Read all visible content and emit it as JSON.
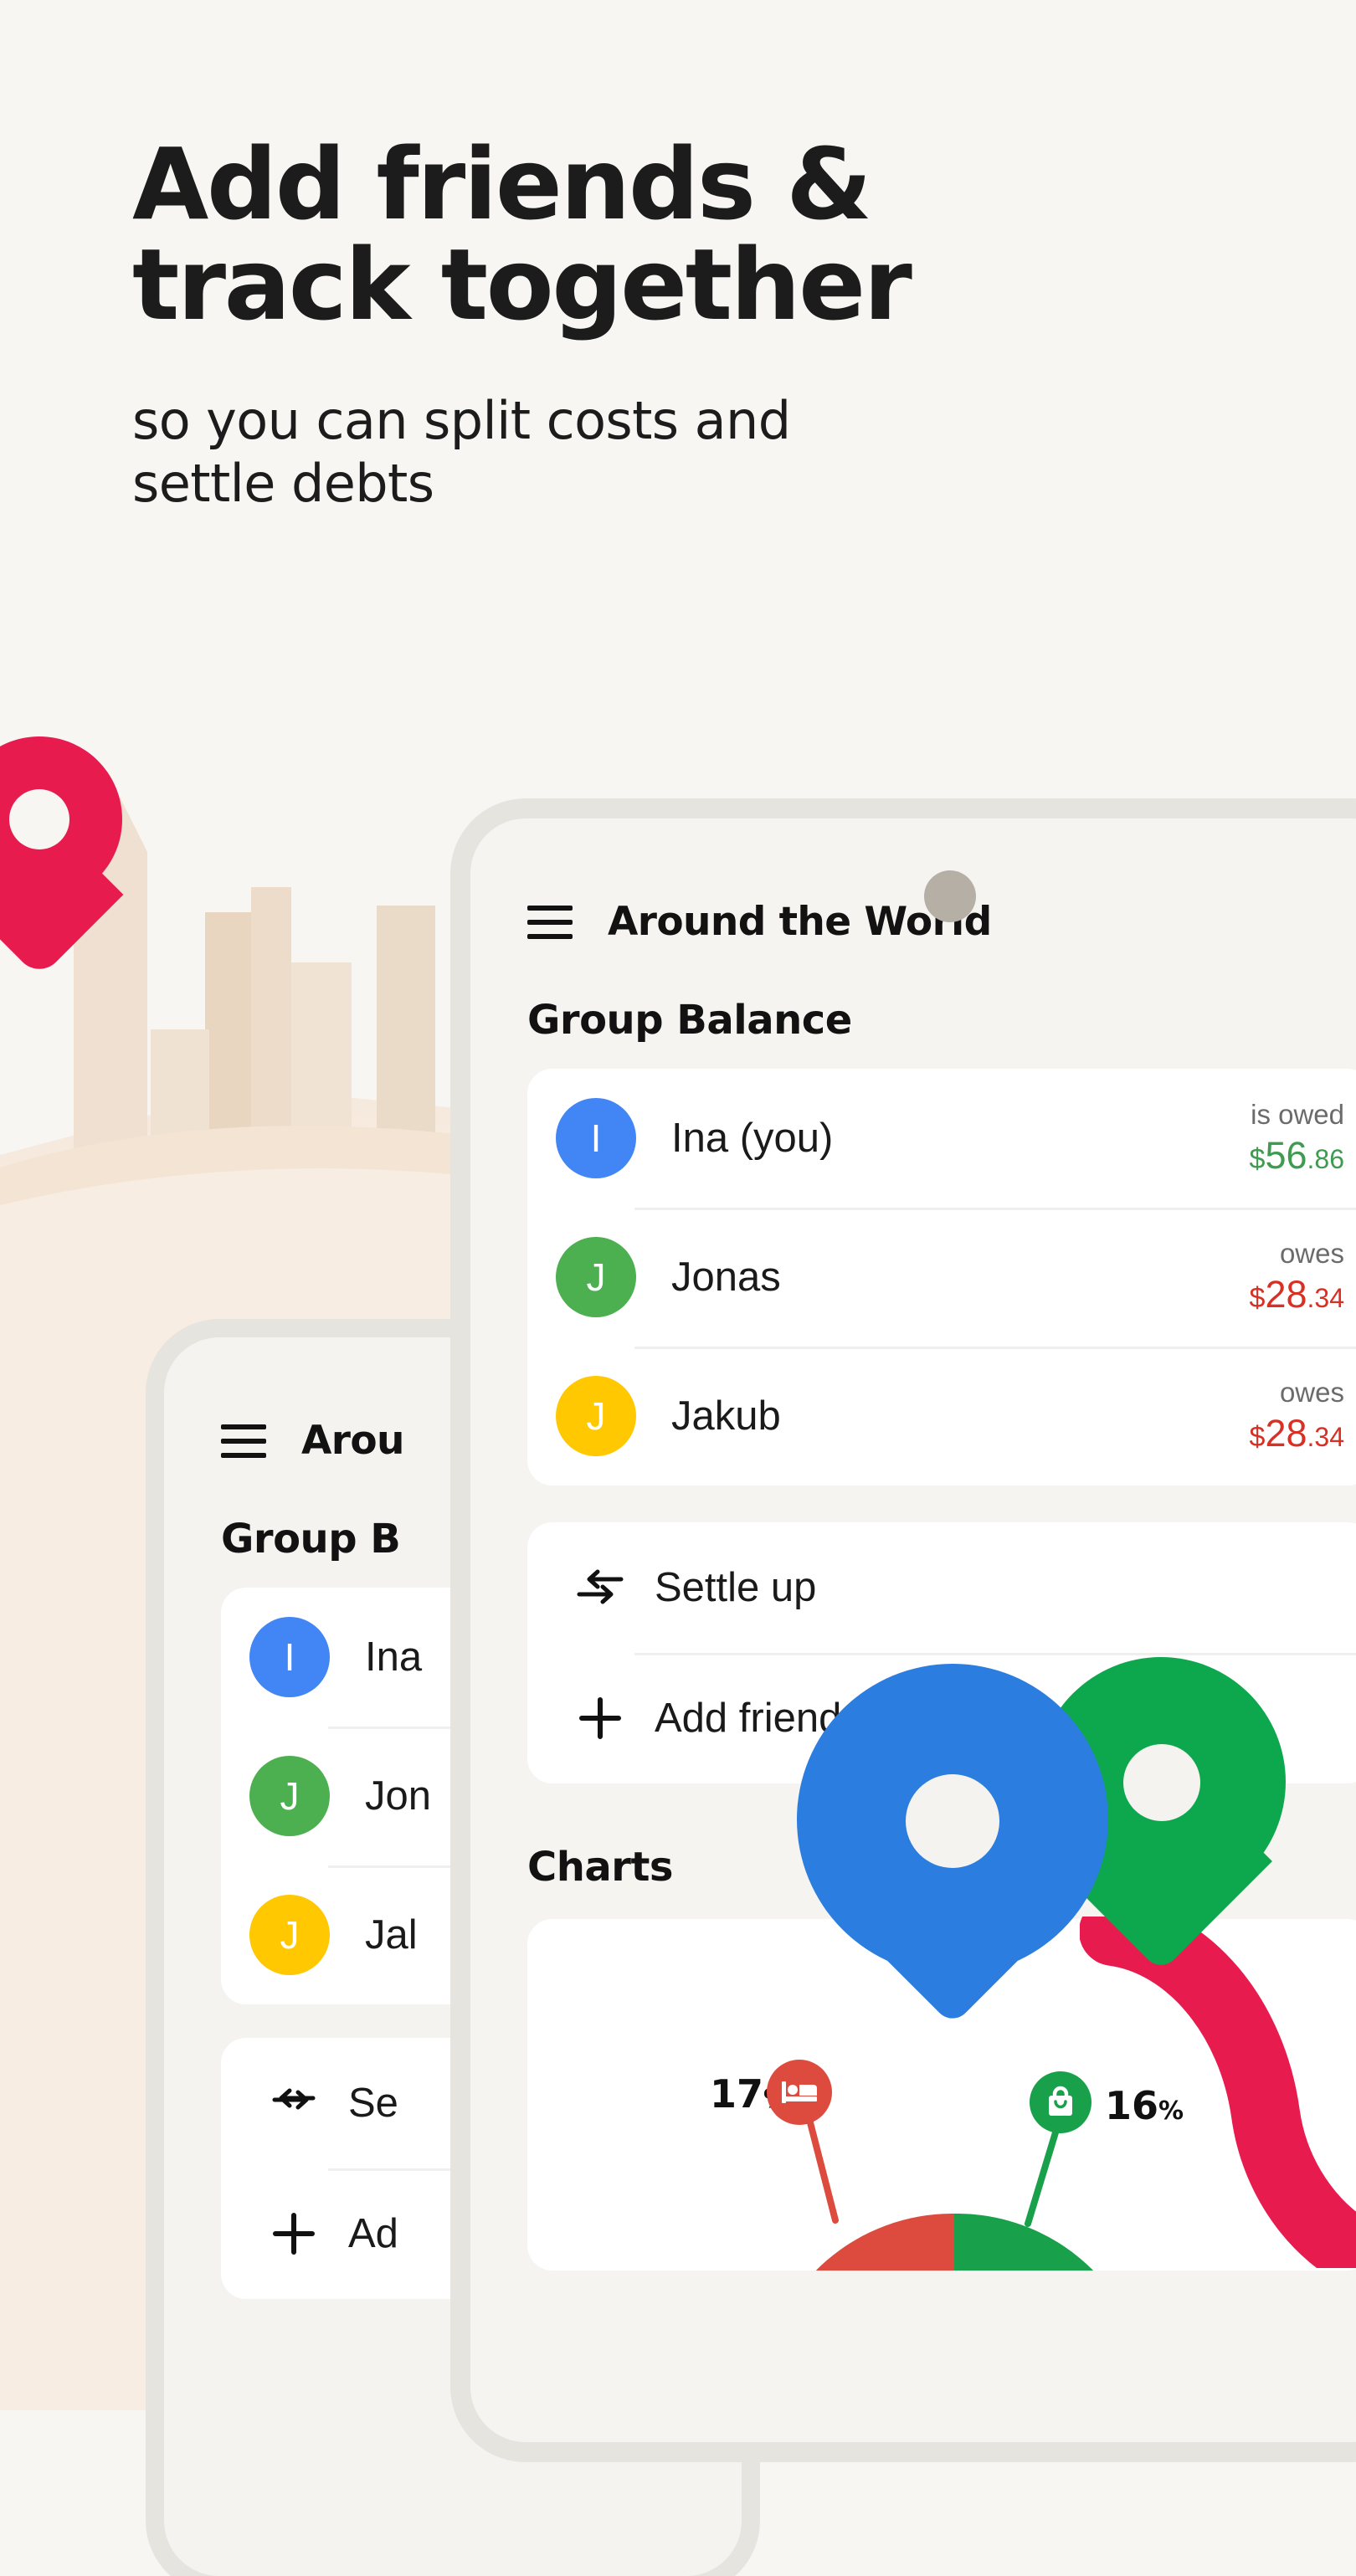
{
  "theme": {
    "background": "#F7F6F2",
    "card_background": "#FFFFFF",
    "phone_body": "#F5F4F0",
    "phone_bezel": "#E6E4DF",
    "text_primary": "#1C1C1C",
    "accent_crimson": "#E81B4F",
    "accent_blue": "#2B7DE0",
    "accent_green": "#0DA84E",
    "positive_green": "#3E9B4F",
    "negative_red": "#D93025",
    "muted_text": "#6B6B6B",
    "city_beige": "#E8D9C8",
    "city_sand": "#F2E6DA"
  },
  "hero": {
    "headline": "Add friends &\ntrack together",
    "subheadline": "so you can split costs and\nsettle debts"
  },
  "phone_front": {
    "app_title": "Around the World",
    "menu_icon": "hamburger-icon",
    "balance_section_title": "Group Balance",
    "members": [
      {
        "initial": "I",
        "avatar_color": "#4285F4",
        "name": "Ina (you)",
        "status": "is owed",
        "currency": "$",
        "whole": "56",
        "cents": ".86",
        "direction": "positive"
      },
      {
        "initial": "J",
        "avatar_color": "#4CAF50",
        "name": "Jonas",
        "status": "owes",
        "currency": "$",
        "whole": "28",
        "cents": ".34",
        "direction": "negative"
      },
      {
        "initial": "J",
        "avatar_color": "#FFC800",
        "name": "Jakub",
        "status": "owes",
        "currency": "$",
        "whole": "28",
        "cents": ".34",
        "direction": "negative"
      }
    ],
    "actions": [
      {
        "icon": "settle-swap-arrows-icon",
        "label": "Settle up"
      },
      {
        "icon": "plus-icon",
        "label": "Add friends"
      }
    ],
    "charts_section_title": "Charts"
  },
  "phone_back": {
    "app_title": "Arou",
    "balance_section_title": "Group B",
    "members": [
      {
        "initial": "I",
        "avatar_color": "#4285F4",
        "name": "Ina"
      },
      {
        "initial": "J",
        "avatar_color": "#4CAF50",
        "name": "Jon"
      },
      {
        "initial": "J",
        "avatar_color": "#FFC800",
        "name": "Jal"
      }
    ],
    "actions": [
      {
        "icon": "settle-swap-arrows-icon",
        "label": "Se"
      },
      {
        "icon": "plus-icon",
        "label": "Ad"
      }
    ]
  },
  "chart_data": {
    "type": "pie",
    "title": "Charts",
    "categories": [
      "Accommodation",
      "Shopping"
    ],
    "values": [
      17,
      16
    ],
    "labels": [
      "17%",
      "16%"
    ],
    "colors": [
      "#DD4B3E",
      "#18A04A"
    ],
    "icons": [
      "bed-icon",
      "shopping-bag-icon"
    ],
    "unit": "%",
    "legend": "callout-bubbles"
  },
  "decorations": {
    "map_pins": [
      {
        "name": "pin-crimson-large",
        "color": "#E81B4F"
      },
      {
        "name": "pin-blue",
        "color": "#2B7DE0"
      },
      {
        "name": "pin-green",
        "color": "#0DA84E"
      },
      {
        "name": "swoosh-crimson",
        "color": "#E81B4F"
      }
    ]
  }
}
